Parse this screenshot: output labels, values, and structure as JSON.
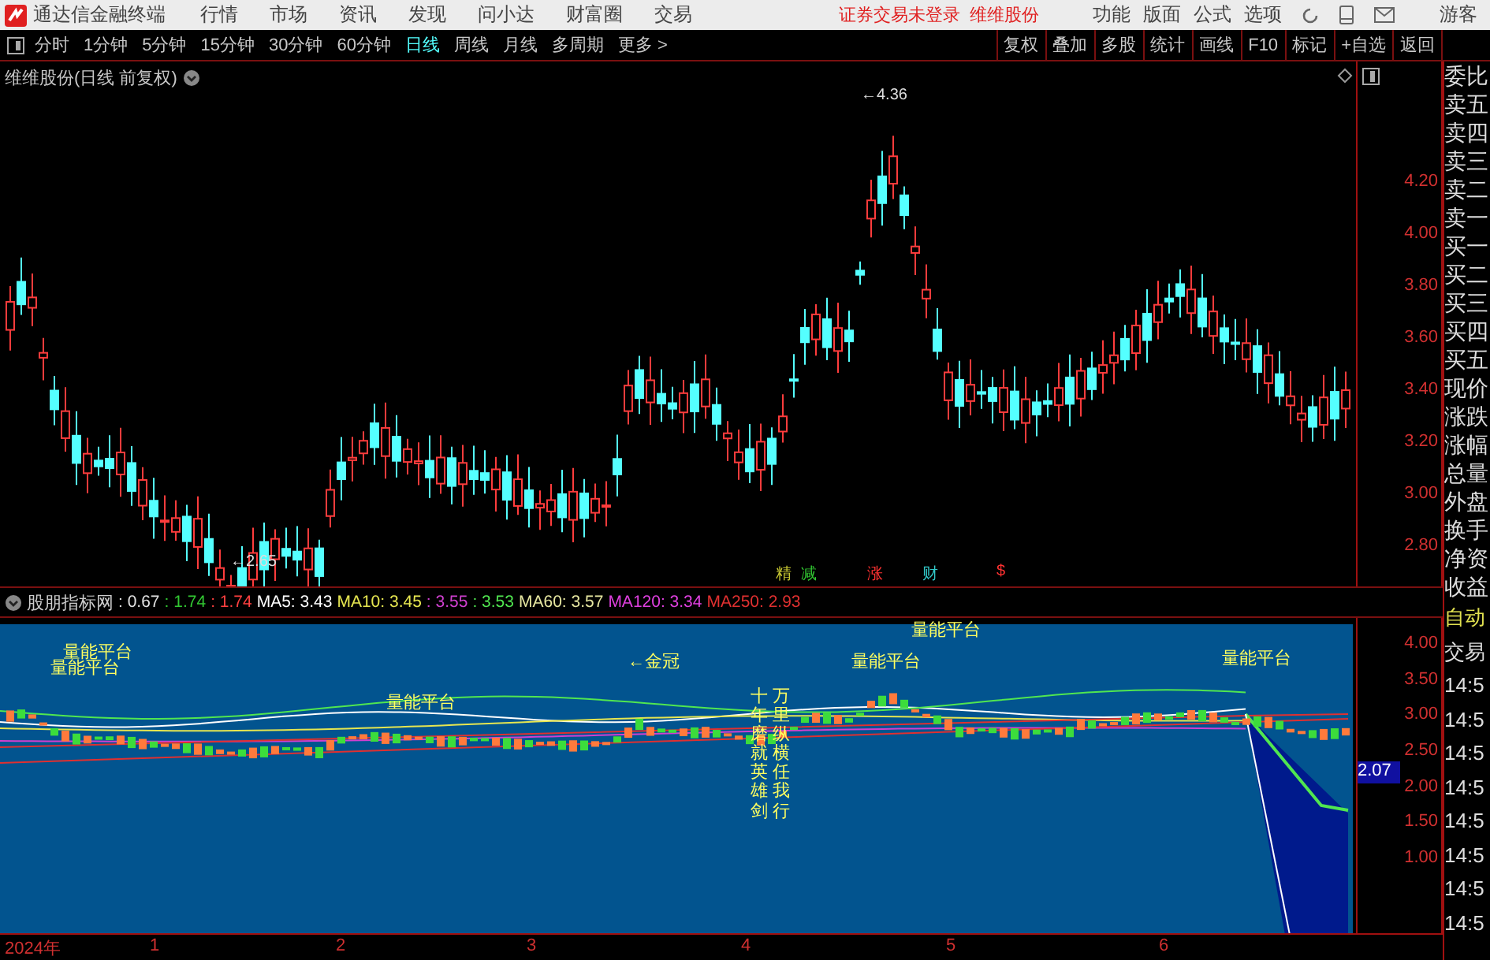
{
  "app": {
    "title": "通达信金融终端",
    "menu": [
      "行情",
      "市场",
      "资讯",
      "发现",
      "问小达",
      "财富圈",
      "交易"
    ],
    "status": [
      "证券交易未登录",
      "维维股份"
    ],
    "menu_right": [
      "功能",
      "版面",
      "公式",
      "选项"
    ],
    "user": "游客"
  },
  "periods": [
    {
      "label": "分时",
      "selected": false
    },
    {
      "label": "1分钟",
      "selected": false
    },
    {
      "label": "5分钟",
      "selected": false
    },
    {
      "label": "15分钟",
      "selected": false
    },
    {
      "label": "30分钟",
      "selected": false
    },
    {
      "label": "60分钟",
      "selected": false
    },
    {
      "label": "日线",
      "selected": true
    },
    {
      "label": "周线",
      "selected": false
    },
    {
      "label": "月线",
      "selected": false
    },
    {
      "label": "多周期",
      "selected": false
    },
    {
      "label": "更多 >",
      "selected": false
    }
  ],
  "tools": [
    "复权",
    "叠加",
    "多股",
    "统计",
    "画线",
    "F10",
    "标记",
    "+自选",
    "返回"
  ],
  "main_chart": {
    "title": "维维股份(日线 前复权)",
    "yticks": [
      "4.20",
      "4.00",
      "3.80",
      "3.60",
      "3.40",
      "3.20",
      "3.00",
      "2.80"
    ],
    "annotations": [
      "←4.36",
      "←2.65"
    ],
    "markers": [
      {
        "text": "精",
        "color": "#c8c832"
      },
      {
        "text": "减",
        "color": "#32c832"
      },
      {
        "text": "涨",
        "color": "#ff3232"
      },
      {
        "text": "财",
        "color": "#32c8c8"
      },
      {
        "text": "$",
        "color": "#ff3232"
      }
    ]
  },
  "indicator": {
    "name": "股朋指标网",
    "values": [
      {
        "text": ": 0.67",
        "color": "#e0e0e0"
      },
      {
        "text": ": 1.74",
        "color": "#32c832"
      },
      {
        "text": ": 1.74",
        "color": "#ff4040"
      },
      {
        "text": "MA5: 3.43",
        "color": "#ffffff"
      },
      {
        "text": "MA10: 3.45",
        "color": "#e6e650"
      },
      {
        "text": ": 3.55",
        "color": "#d040d0"
      },
      {
        "text": ": 3.53",
        "color": "#50e650"
      },
      {
        "text": "MA60: 3.57",
        "color": "#e6e6a0"
      },
      {
        "text": "MA120: 3.34",
        "color": "#e040e0"
      },
      {
        "text": "MA250: 2.93",
        "color": "#e03030"
      }
    ],
    "labels": [
      "量能平台",
      "量能平台",
      "量能平台",
      "←金冠",
      "量能平台",
      "量能平台",
      "量能平台"
    ],
    "vertical_texts": [
      "十年磨就英雄剑",
      "万里纵横任我行"
    ],
    "yticks": [
      "4.00",
      "3.50",
      "3.00",
      "2.50",
      "2.00",
      "1.50",
      "1.00"
    ],
    "current": "2.07"
  },
  "x_axis": [
    "2024年",
    "1",
    "2",
    "3",
    "4",
    "5",
    "6"
  ],
  "side_panel": {
    "labels": [
      "委比",
      "卖五",
      "卖四",
      "卖三",
      "卖二",
      "卖一",
      "买一",
      "买二",
      "买三",
      "买四",
      "买五",
      "现价",
      "涨跌",
      "涨幅",
      "总量",
      "外盘",
      "换手",
      "净资",
      "收益"
    ],
    "trade": [
      "自动",
      "交易"
    ],
    "times": [
      "14:5",
      "14:5",
      "14:5",
      "14:5",
      "14:5",
      "14:5",
      "14:5",
      "14:5"
    ]
  }
}
